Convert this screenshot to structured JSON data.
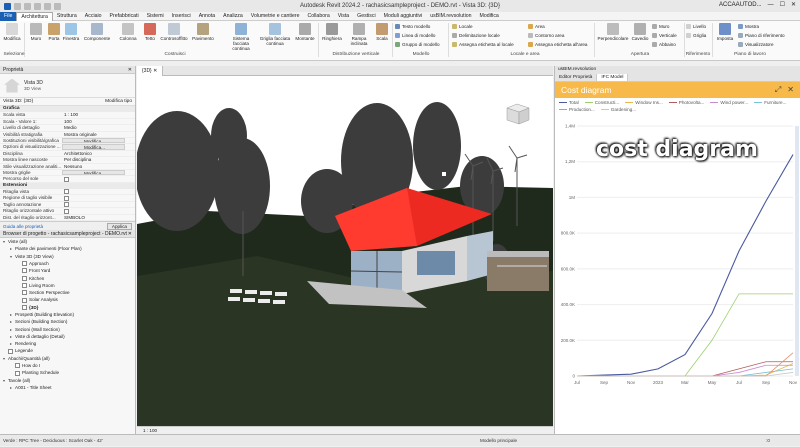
{
  "app": {
    "title": "Autodesk Revit 2024.2 - rachasicsampleproject - DEMO.rvt - Vista 3D: {3D}",
    "user": "ACCAAUTOD..."
  },
  "tabs": [
    "File",
    "Architettura",
    "Struttura",
    "Acciaio",
    "Prefabbricati",
    "Sistemi",
    "Inserisci",
    "Annota",
    "Analizza",
    "Volumetrie e cantiere",
    "Collabora",
    "Vista",
    "Gestisci",
    "Moduli aggiuntivi",
    "usBIM.revsolution",
    "Modifica"
  ],
  "active_tab": "Architettura",
  "ribbon": {
    "buttons": [
      {
        "label": "Modifica"
      },
      {
        "label": "Muro"
      },
      {
        "label": "Porta"
      },
      {
        "label": "Finestra"
      },
      {
        "label": "Componente"
      },
      {
        "label": "Colonna"
      },
      {
        "label": "Tetto"
      },
      {
        "label": "Controsoffitto"
      },
      {
        "label": "Pavimento"
      },
      {
        "label": "Sistema facciata continua"
      },
      {
        "label": "Griglia facciata continua"
      },
      {
        "label": "Montante"
      },
      {
        "label": "Ringhiera"
      },
      {
        "label": "Rampa inclinata"
      },
      {
        "label": "Scala"
      }
    ],
    "small": [
      "Testo modello",
      "Linea di modello",
      "Gruppo di modello",
      "Locale",
      "Delimitazione locale",
      "Assegna etichetta al locale",
      "Area",
      "Contorno area",
      "Assegna etichetta all'area",
      "Perpendicolare",
      "Cavedio",
      "Muro",
      "Verticale",
      "Abbaino",
      "Livello",
      "Griglia",
      "Imposta",
      "Mostra",
      "Piano di riferimento",
      "Visualizzatore"
    ],
    "groups": [
      "Selezione",
      "Costruisci",
      "Distribuzione verticale",
      "Modello",
      "Locale e area",
      "Apertura",
      "Riferimento",
      "Piano di lavoro"
    ]
  },
  "properties": {
    "header": "Proprietà",
    "type_name": "Vista 3D",
    "type_sub": "3D View",
    "selector": "Vista 3D: {3D}",
    "edit_type": "Modifica tipo",
    "sections": [
      {
        "name": "Grafica",
        "rows": [
          {
            "k": "Scala vista",
            "v": "1 : 100"
          },
          {
            "k": "Scala - Valore 1:",
            "v": "100"
          },
          {
            "k": "Livello di dettaglio",
            "v": "Medio"
          },
          {
            "k": "Visibilità stratigrafia",
            "v": "Mostra originale"
          },
          {
            "k": "Sostituzioni visibilità/grafica",
            "v": "Modifica...",
            "btn": true
          },
          {
            "k": "Opzioni di visualizzazione ...",
            "v": "Modifica...",
            "btn": true
          },
          {
            "k": "Disciplina",
            "v": "Architettonico"
          },
          {
            "k": "Mostra linee nascoste",
            "v": "Per disciplina"
          },
          {
            "k": "Stile visualizzazione analiti...",
            "v": "Nessuno"
          },
          {
            "k": "Mostra griglie",
            "v": "Modifica...",
            "btn": true
          },
          {
            "k": "Percorso del sole",
            "v": ""
          }
        ]
      },
      {
        "name": "Estensioni",
        "rows": [
          {
            "k": "Ritaglia vista",
            "v": ""
          },
          {
            "k": "Regione di taglio visibile",
            "v": ""
          },
          {
            "k": "Taglio annotazione",
            "v": ""
          },
          {
            "k": "Ritaglio orizzontale attivo",
            "v": ""
          },
          {
            "k": "Dist. del ritaglio orizzont...",
            "v": "SIMBOLO"
          }
        ]
      }
    ],
    "help": "Guida alle proprietà",
    "apply": "Applica"
  },
  "browser": {
    "header": "Browser di progetto - rachasicsampleproject - DEMO.rvt",
    "items": [
      {
        "label": "Viste (all)",
        "lvl": 0,
        "tg": "−"
      },
      {
        "label": "Piante dei pavimenti (Floor Plan)",
        "lvl": 1,
        "tg": "+"
      },
      {
        "label": "Viste 3D (3D View)",
        "lvl": 1,
        "tg": "−"
      },
      {
        "label": "Approach",
        "lvl": 2,
        "box": true
      },
      {
        "label": "Front Yard",
        "lvl": 2,
        "box": true
      },
      {
        "label": "Kitchen",
        "lvl": 2,
        "box": true
      },
      {
        "label": "Living Room",
        "lvl": 2,
        "box": true
      },
      {
        "label": "Section Perspective",
        "lvl": 2,
        "box": true
      },
      {
        "label": "Solar Analysis",
        "lvl": 2,
        "box": true
      },
      {
        "label": "{3D}",
        "lvl": 2,
        "box": true,
        "bold": true
      },
      {
        "label": "Prospetti (Building Elevation)",
        "lvl": 1,
        "tg": "+"
      },
      {
        "label": "Sezioni (Building Section)",
        "lvl": 1,
        "tg": "+"
      },
      {
        "label": "Sezioni (Wall Section)",
        "lvl": 1,
        "tg": "+"
      },
      {
        "label": "Viste di dettaglio (Detail)",
        "lvl": 1,
        "tg": "+"
      },
      {
        "label": "Rendering",
        "lvl": 1,
        "tg": "+"
      },
      {
        "label": "Legende",
        "lvl": 0,
        "box": true
      },
      {
        "label": "Abachi/Quantità (all)",
        "lvl": 0,
        "tg": "−"
      },
      {
        "label": "How do I",
        "lvl": 1,
        "box": true
      },
      {
        "label": "Planting Schedule",
        "lvl": 1,
        "box": true
      },
      {
        "label": "Tavole (all)",
        "lvl": 0,
        "tg": "−"
      },
      {
        "label": "A001 - Title Sheet",
        "lvl": 1,
        "tg": "+"
      }
    ]
  },
  "viewport": {
    "tab": "{3D}",
    "scale": "1 : 100"
  },
  "right_panel": {
    "window_title": "usBIM.revsolution",
    "tabs": [
      "Editor Proprietà",
      "IFC Model"
    ],
    "chart_title": "Cost diagram"
  },
  "overlay": "cost diagram",
  "chart_data": {
    "type": "line",
    "title": "Cost diagram",
    "x": [
      "Jul",
      "Sep",
      "Nov",
      "2023",
      "Mar",
      "May",
      "Jul",
      "Sep",
      "Nov"
    ],
    "yticks": [
      "0",
      "200.0K",
      "400.0K",
      "600.0K",
      "800.0K",
      "1M",
      "1,2M",
      "1,4M"
    ],
    "ylim": [
      0,
      1400000
    ],
    "series": [
      {
        "name": "Total",
        "color": "#4a5aa0",
        "values": [
          0,
          5000,
          10000,
          40000,
          120000,
          350000,
          700000,
          980000,
          1240000
        ]
      },
      {
        "name": "Constructi...",
        "color": "#9bcf6a",
        "values": [
          0,
          0,
          0,
          0,
          0,
          200000,
          460000,
          460000,
          460000
        ]
      },
      {
        "name": "Window Ins...",
        "color": "#e8b84a",
        "values": [
          0,
          0,
          0,
          0,
          0,
          0,
          0,
          5000,
          70000
        ]
      },
      {
        "name": "Photovolta...",
        "color": "#b05a5a",
        "values": [
          0,
          0,
          0,
          0,
          0,
          0,
          40000,
          80000,
          80000
        ]
      },
      {
        "name": "Wind power...",
        "color": "#c98ad0",
        "values": [
          0,
          0,
          0,
          0,
          0,
          0,
          20000,
          60000,
          60000
        ]
      },
      {
        "name": "Furniture...",
        "color": "#7ac0d8",
        "values": [
          0,
          0,
          0,
          0,
          0,
          0,
          0,
          20000,
          40000
        ]
      },
      {
        "name": "Production...",
        "color": "#e0906a",
        "values": [
          0,
          0,
          0,
          0,
          0,
          0,
          0,
          0,
          130000
        ]
      },
      {
        "name": "Gardening...",
        "color": "#c8c8c8",
        "values": [
          0,
          0,
          0,
          0,
          0,
          0,
          0,
          0,
          20000
        ]
      }
    ]
  },
  "status": {
    "left": "Verde : RPC Tree - Deciduous : Scarlet Oak - 42'",
    "mid": "Modello principale",
    "right": ":0"
  }
}
